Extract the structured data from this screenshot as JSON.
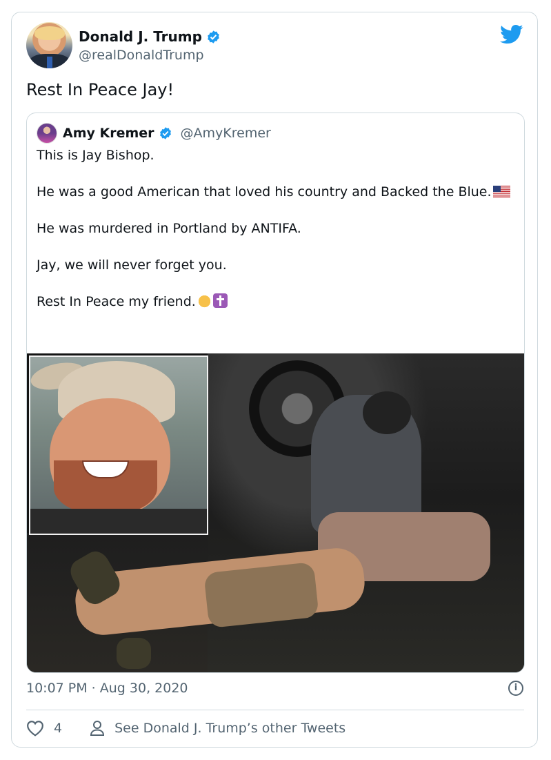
{
  "tweet": {
    "author": {
      "name": "Donald J. Trump",
      "handle": "@realDonaldTrump",
      "verified": true,
      "avatar_icon": "profile-photo"
    },
    "text": "Rest In Peace Jay!",
    "timestamp": "10:07 PM · Aug 30, 2020",
    "likes": "4",
    "other_tweets_link": "See Donald J. Trump’s other Tweets",
    "brand_color": "#1d9bf0"
  },
  "quote": {
    "author": {
      "name": "Amy Kremer",
      "handle": "@AmyKremer",
      "verified": true
    },
    "paragraphs": [
      {
        "text": "This is Jay Bishop.",
        "emoji": []
      },
      {
        "text": "He was a good American that loved his country and Backed the Blue.",
        "emoji": [
          "us-flag"
        ]
      },
      {
        "text": "He was murdered in Portland by ANTIFA.",
        "emoji": []
      },
      {
        "text": "Jay, we will never forget you.",
        "emoji": []
      },
      {
        "text": "Rest In Peace my friend.",
        "emoji": [
          "folded-hands",
          "latin-cross"
        ]
      }
    ],
    "media": {
      "inset_photo": "smiling-man-in-cap",
      "scene_photo": "officers-kneeling-over-person-on-ground-at-night"
    }
  },
  "icons": {
    "bird": "twitter-bird-icon",
    "info": "info-icon",
    "heart": "heart-icon",
    "person": "person-icon"
  }
}
